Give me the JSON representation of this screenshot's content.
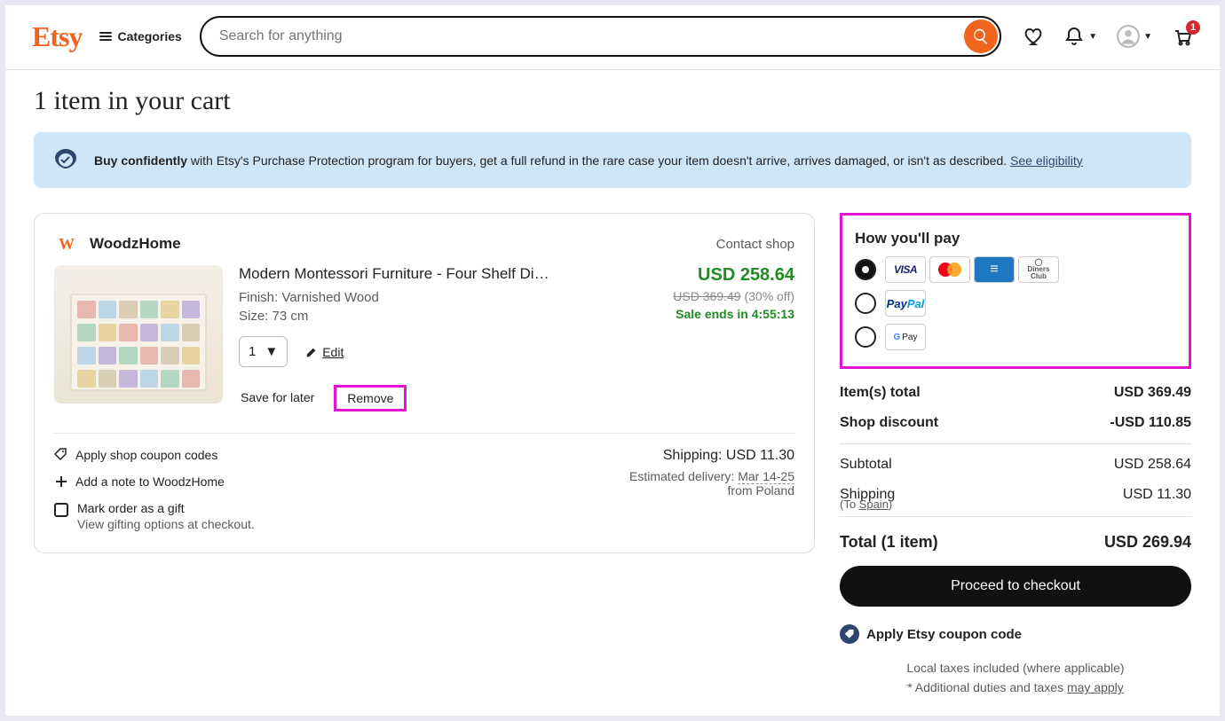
{
  "header": {
    "categories_label": "Categories",
    "search_placeholder": "Search for anything",
    "cart_count": "1"
  },
  "page_title": "1 item in your cart",
  "pp_banner": {
    "bold": "Buy confidently",
    "text": " with Etsy's Purchase Protection program for buyers, get a full refund in the rare case your item doesn't arrive, arrives damaged, or isn't as described. ",
    "link": "See eligibility"
  },
  "shop": {
    "name": "WoodzHome",
    "contact": "Contact shop"
  },
  "item": {
    "title": "Modern Montessori Furniture - Four Shelf Di…",
    "finish_label": "Finish: Varnished Wood",
    "size_label": "Size: 73 cm",
    "quantity": "1",
    "edit_label": "Edit",
    "save_later_label": "Save for later",
    "remove_label": "Remove"
  },
  "price": {
    "now": "USD 258.64",
    "original": "USD 369.49",
    "discount": "(30% off)",
    "sale_ends_prefix": "Sale ends in ",
    "sale_ends_time": "4:55:13"
  },
  "actions": {
    "coupon": "Apply shop coupon codes",
    "note": "Add a note to WoodzHome",
    "gift_title": "Mark order as a gift",
    "gift_sub": "View gifting options at checkout."
  },
  "shipping": {
    "label": "Shipping: USD 11.30",
    "est_prefix": "Estimated delivery: ",
    "est_date": "Mar 14-25",
    "from": "from Poland"
  },
  "pay": {
    "title": "How you'll pay"
  },
  "totals": {
    "items_label": "Item(s) total",
    "items_val": "USD 369.49",
    "discount_label": "Shop discount",
    "discount_val": "-USD 110.85",
    "subtotal_label": "Subtotal",
    "subtotal_val": "USD 258.64",
    "ship_label": "Shipping",
    "ship_val": "USD 11.30",
    "ship_to_prefix": "(To ",
    "ship_to_country": "Spain",
    "ship_to_suffix": ")",
    "total_label": "Total (1 item)",
    "total_val": "USD 269.94"
  },
  "checkout": {
    "button": "Proceed to checkout",
    "apply_code": "Apply Etsy coupon code",
    "tax_line1": "Local taxes included (where applicable)",
    "tax_line2_prefix": "* Additional duties and taxes ",
    "tax_line2_link": "may apply"
  }
}
